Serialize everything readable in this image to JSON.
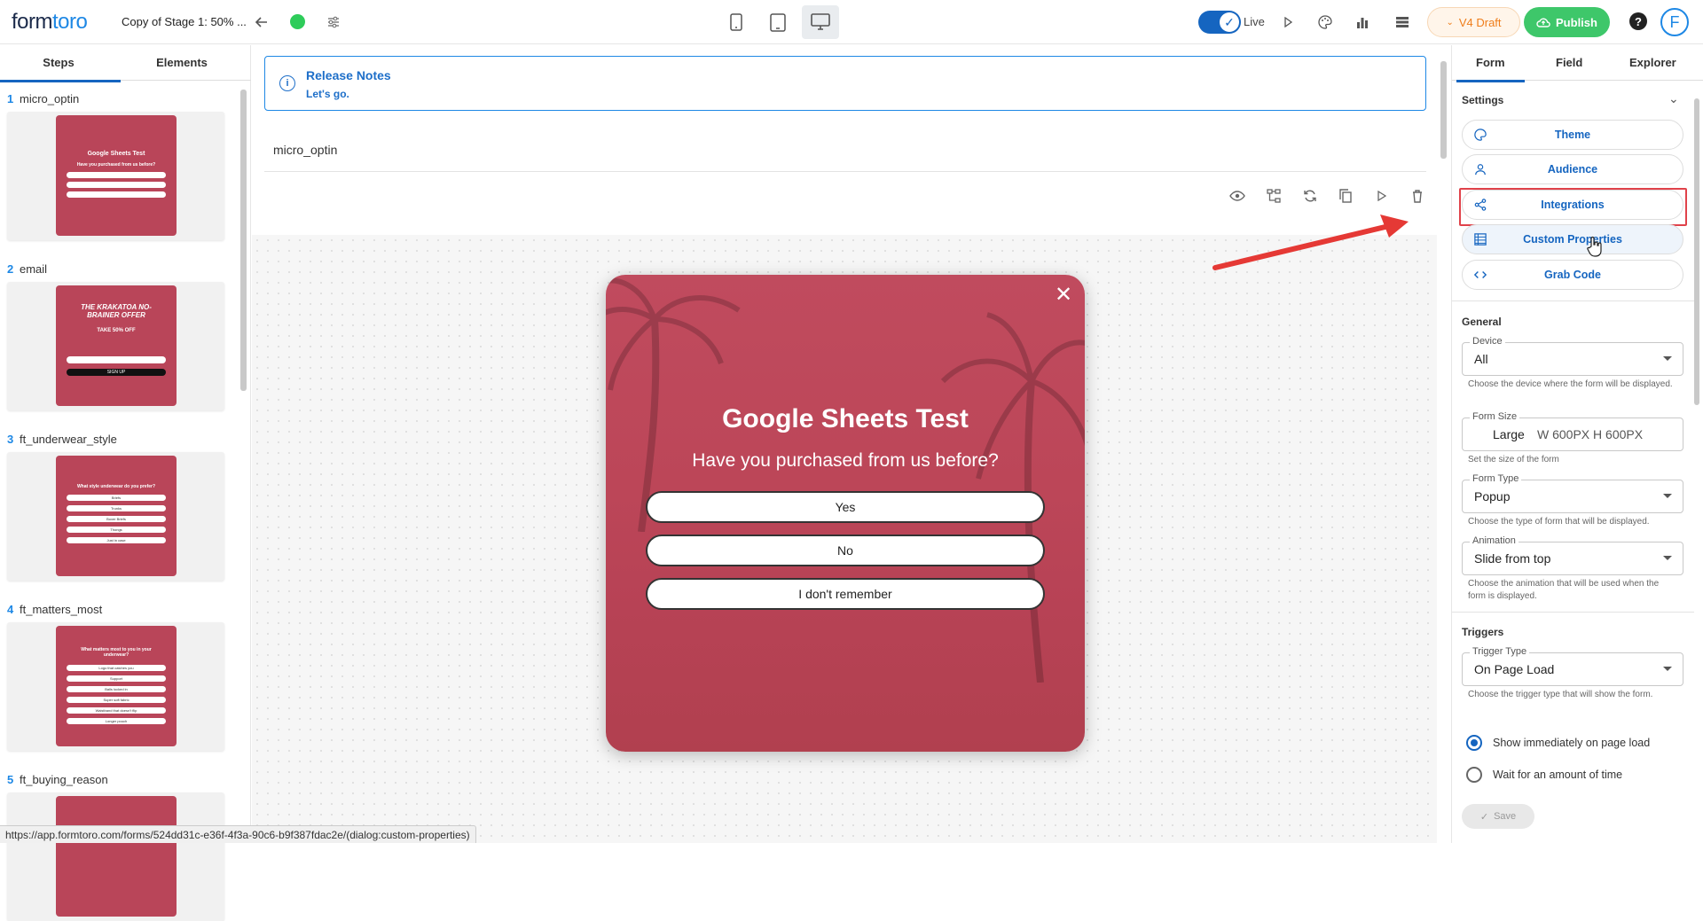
{
  "header": {
    "logo_prefix": "form",
    "logo_suffix": "toro",
    "form_name": "Copy of Stage 1: 50% ...",
    "live_label": "Live",
    "draft_label": "V4 Draft",
    "publish_label": "Publish",
    "help_label": "?",
    "avatar_letter": "F",
    "status_color": "#2ecc5a"
  },
  "left": {
    "tabs": [
      "Steps",
      "Elements"
    ],
    "steps": [
      {
        "num": "1",
        "name": "micro_optin",
        "title": "Google Sheets Test",
        "subtitle": "Have you purchased from us before?",
        "options": [
          "Yes",
          "No",
          "I don't remember"
        ]
      },
      {
        "num": "2",
        "name": "email",
        "title": "THE KRAKATOA NO-BRAINER OFFER",
        "subtitle": "TAKE 50% OFF",
        "options": [
          "",
          "SIGN UP"
        ]
      },
      {
        "num": "3",
        "name": "ft_underwear_style",
        "title": "What style underwear do you prefer?",
        "subtitle": "",
        "options": [
          "Briefs",
          "Trunks",
          "Boxer Briefs",
          "Thongs",
          "Just in case"
        ]
      },
      {
        "num": "4",
        "name": "ft_matters_most",
        "title": "What matters most to you in your underwear?",
        "subtitle": "",
        "options": [
          "Logo that catches you",
          "Support",
          "Balls locked in",
          "Super soft fabric",
          "Waistband that doesn't flip",
          "Longer pouch"
        ]
      },
      {
        "num": "5",
        "name": "ft_buying_reason",
        "title": "",
        "subtitle": "",
        "options": []
      }
    ]
  },
  "canvas": {
    "release_title": "Release Notes",
    "release_sub": "Let's go.",
    "step_name": "micro_optin",
    "popup": {
      "title": "Google Sheets Test",
      "subtitle": "Have you purchased from us before?",
      "options": [
        "Yes",
        "No",
        "I don't remember"
      ],
      "bg_color": "#bc4658"
    }
  },
  "right": {
    "tabs": [
      "Form",
      "Field",
      "Explorer"
    ],
    "settings_title": "Settings",
    "settings_buttons": [
      "Theme",
      "Audience",
      "Integrations",
      "Custom Properties",
      "Grab Code"
    ],
    "general_title": "General",
    "device": {
      "label": "Device",
      "value": "All",
      "help": "Choose the device where the form will be displayed."
    },
    "form_size": {
      "label": "Form Size",
      "value": "Large",
      "dims": "W 600PX H 600PX",
      "help": "Set the size of the form"
    },
    "form_type": {
      "label": "Form Type",
      "value": "Popup",
      "help": "Choose the type of form that will be displayed."
    },
    "animation": {
      "label": "Animation",
      "value": "Slide from top",
      "help": "Choose the animation that will be used when the form is displayed."
    },
    "triggers_title": "Triggers",
    "trigger_type": {
      "label": "Trigger Type",
      "value": "On Page Load",
      "help": "Choose the trigger type that will show the form."
    },
    "radios": [
      "Show immediately on page load",
      "Wait for an amount of time"
    ],
    "save_label": "Save"
  },
  "status_url": "https://app.formtoro.com/forms/524dd31c-e36f-4f3a-90c6-b9f387fdac2e/(dialog:custom-properties)",
  "colors": {
    "accent": "#1565c0",
    "highlight": "#e0424a",
    "publish": "#3ec76a",
    "draft": "#ef7d1a"
  }
}
